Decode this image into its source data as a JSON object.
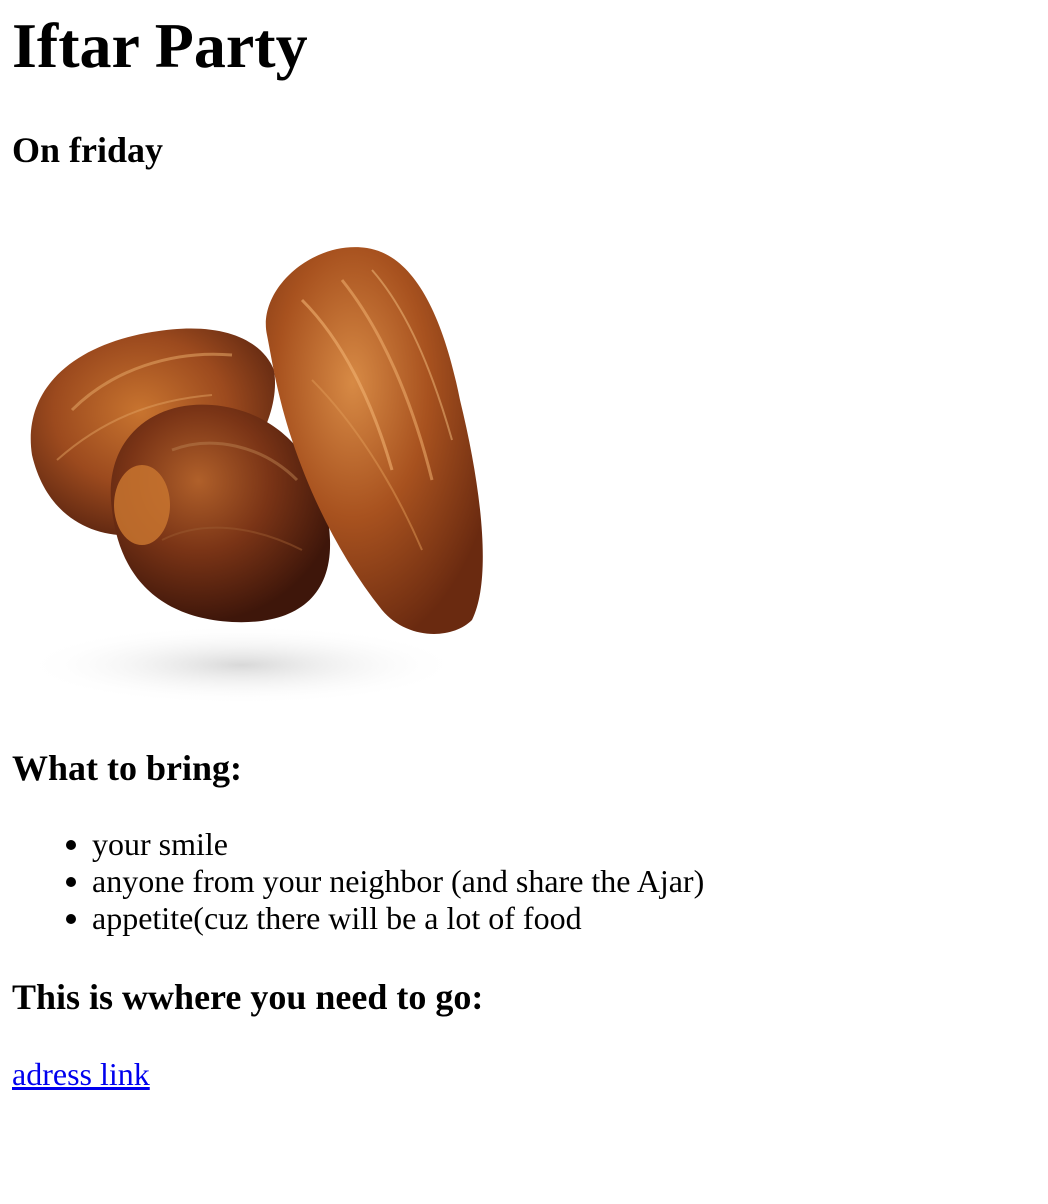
{
  "page": {
    "title": "Iftar Party",
    "subtitle": "On friday"
  },
  "image": {
    "icon": "dates-photo"
  },
  "bring": {
    "heading": "What to bring:",
    "items": [
      "your smile",
      "anyone from your neighbor (and share the Ajar)",
      "appetite(cuz there will be a lot of food"
    ]
  },
  "location": {
    "heading": "This is wwhere you need to go:",
    "link_text": "adress link"
  },
  "colors": {
    "link": "#0000ee",
    "date_dark": "#5a2410",
    "date_mid": "#9c4a1e",
    "date_light": "#c8742f"
  }
}
